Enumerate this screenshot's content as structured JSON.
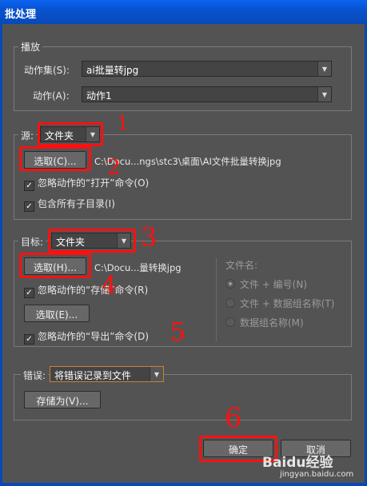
{
  "window": {
    "title": "批处理"
  },
  "play": {
    "group_label": "播放",
    "set_label": "动作集(S):",
    "set_value": "ai批量转jpg",
    "action_label": "动作(A):",
    "action_value": "动作1"
  },
  "source": {
    "label": "源:",
    "value": "文件夹",
    "choose_button": "选取(C)...",
    "path": "C:\\Docu...ngs\\stc3\\桌面\\AI文件批量转换jpg",
    "override_open": "忽略动作的“打开”命令(O)",
    "override_open_checked": true,
    "include_subfolders": "包含所有子目录(I)",
    "include_subfolders_checked": true
  },
  "destination": {
    "label": "目标:",
    "value": "文件夹",
    "choose_button": "选取(H)...",
    "path": "C:\\Docu...量转换jpg",
    "override_save": "忽略动作的“存储”命令(R)",
    "override_save_checked": true,
    "choose_button_2": "选取(E)...",
    "override_export": "忽略动作的“导出”命令(D)",
    "override_export_checked": true,
    "file_naming_label": "文件名:",
    "file_naming_options": [
      "文件 + 编号(N)",
      "文件 + 数据组名称(T)",
      "数据组名称(M)"
    ],
    "file_naming_selected": 0
  },
  "errors": {
    "label": "错误:",
    "value": "将错误记录到文件",
    "save_as_button": "存储为(V)..."
  },
  "buttons": {
    "ok": "确定",
    "cancel": "取消"
  },
  "annotations": {
    "marks": [
      "1",
      "2",
      "3",
      "4",
      "5",
      "6"
    ],
    "color": "#ff1010"
  },
  "watermark": {
    "logo": "Baidu经验",
    "url": "jingyan.baidu.com"
  }
}
